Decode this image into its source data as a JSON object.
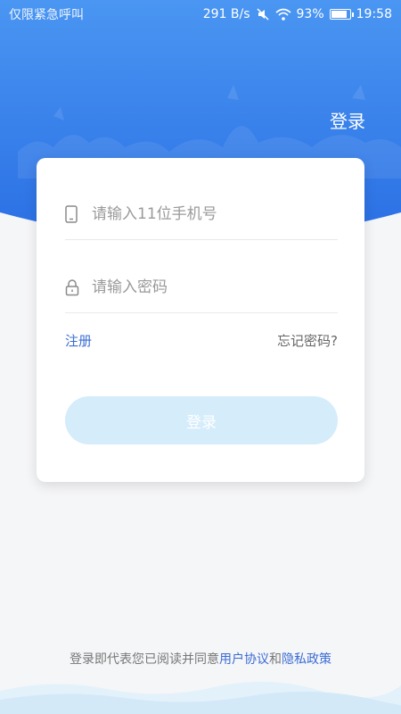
{
  "status_bar": {
    "carrier": "仅限紧急呼叫",
    "net_speed": "291 B/s",
    "battery": "93%",
    "battery_level": 0.93,
    "time": "19:58"
  },
  "header": {
    "title": "登录"
  },
  "form": {
    "phone_placeholder": "请输入11位手机号",
    "password_placeholder": "请输入密码",
    "register_label": "注册",
    "forgot_label": "忘记密码?",
    "login_label": "登录"
  },
  "footer": {
    "prefix": "登录即代表您已阅读并同意",
    "user_agreement": "用户协议",
    "and": "和",
    "privacy_policy": "隐私政策"
  },
  "colors": {
    "hero_top": "#3d8cf0",
    "hero_bottom": "#2f77e8",
    "link": "#3b6cd4",
    "button_disabled": "#d5ecfb",
    "background": "#f5f6f8"
  },
  "icons": [
    "mute-icon",
    "wifi-icon",
    "battery-icon",
    "phone-icon",
    "lock-icon"
  ]
}
